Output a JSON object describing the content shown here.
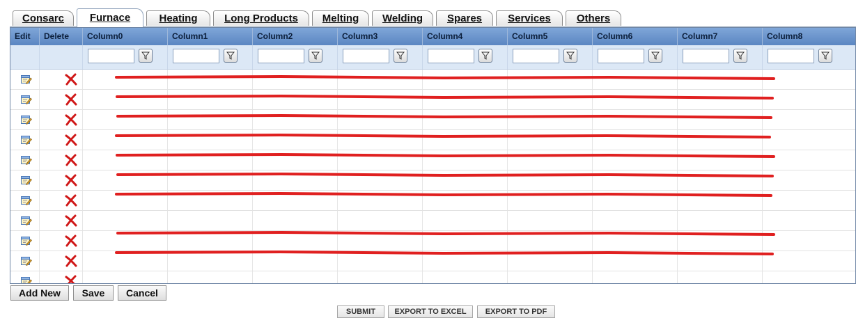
{
  "tabs": [
    {
      "label": "Consarc",
      "active": false
    },
    {
      "label": "Furnace",
      "active": true
    },
    {
      "label": "Heating",
      "active": false
    },
    {
      "label": "Long Products",
      "active": false
    },
    {
      "label": "Melting",
      "active": false
    },
    {
      "label": "Welding",
      "active": false
    },
    {
      "label": "Spares",
      "active": false
    },
    {
      "label": "Services",
      "active": false
    },
    {
      "label": "Others",
      "active": false
    }
  ],
  "grid": {
    "headers": [
      "Edit",
      "Delete",
      "Column0",
      "Column1",
      "Column2",
      "Column3",
      "Column4",
      "Column5",
      "Column6",
      "Column7",
      "Column8"
    ],
    "filter_values": [
      "",
      "",
      "",
      "",
      "",
      "",
      "",
      "",
      "",
      ""
    ],
    "row_count": 11,
    "icons": {
      "edit": "edit-icon",
      "delete": "delete-x-icon",
      "filter": "filter-funnel-icon"
    },
    "redaction_color": "#e02020",
    "redacted_rows": [
      true,
      true,
      true,
      true,
      true,
      true,
      true,
      false,
      true,
      true,
      false
    ]
  },
  "actions": {
    "add_new": "Add New",
    "save": "Save",
    "cancel": "Cancel"
  },
  "footer": {
    "submit": "SUBMIT",
    "export_excel": "EXPORT TO EXCEL",
    "export_pdf": "EXPORT TO PDF"
  }
}
